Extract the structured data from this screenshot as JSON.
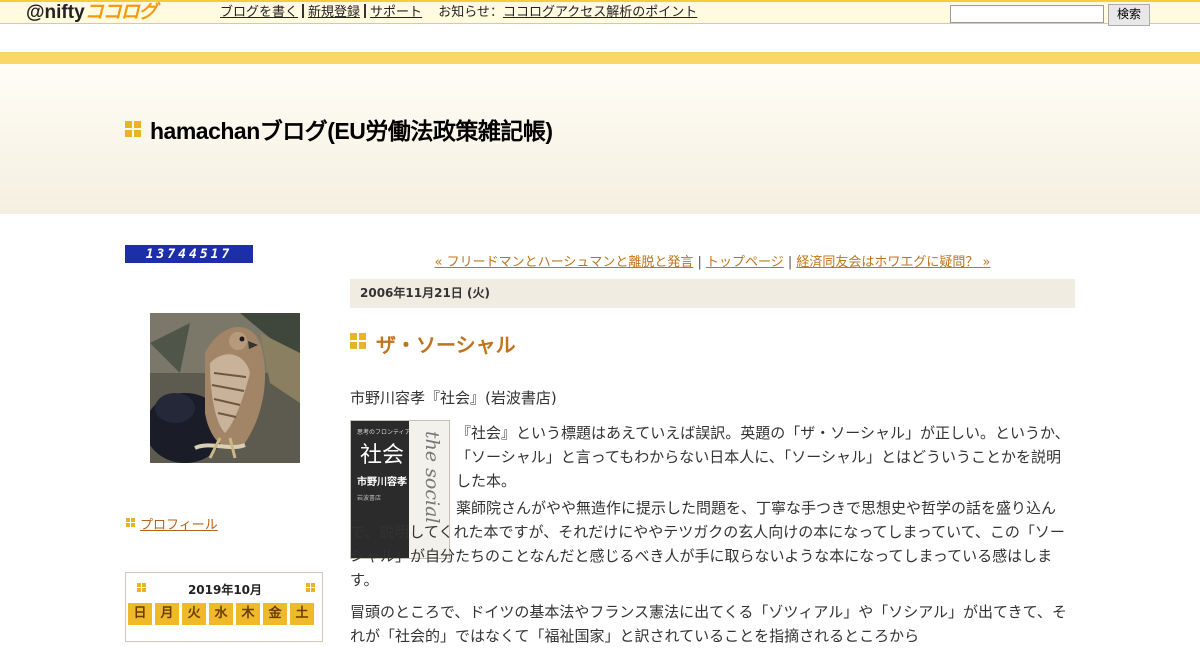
{
  "topbar": {
    "logo_at": "@nifty",
    "logo_coco": "ココログ",
    "nav": [
      {
        "label": "ブログを書く"
      },
      {
        "label": "新規登録"
      },
      {
        "label": "サポート"
      }
    ],
    "news_prefix": "お知らせ",
    "news_colon": "：",
    "news_link": "ココログアクセス解析のポイント",
    "search_placeholder": "",
    "search_button": "検索"
  },
  "header": {
    "blog_title": "hamachanブログ(EU労働法政策雑記帳)"
  },
  "sidebar": {
    "counter": "13744517",
    "profile_link": "プロフィール",
    "calendar": {
      "title": "2019年10月",
      "weekdays": [
        "日",
        "月",
        "火",
        "水",
        "木",
        "金",
        "土"
      ]
    }
  },
  "main": {
    "nav": {
      "prev": "« フリードマンとハーシュマンと離脱と発言",
      "sep1": " | ",
      "top": "トップページ",
      "sep2": " | ",
      "next": "経済同友会はホワエグに疑問？ »"
    },
    "date": "2006年11月21日 (火)",
    "entry_title": "ザ・ソーシャル",
    "book_line": "市野川容孝『社会』(岩波書店)",
    "book_cover": {
      "series": "思考のフロンティア",
      "title": "社会",
      "author": "市野川容孝",
      "script": "the social",
      "publisher": "岩波書店"
    },
    "paragraph1": "『社会』という標題はあえていえば誤訳。英題の「ザ・ソーシャル」が正しい。というか、「ソーシャル」と言ってもわからない日本人に、「ソーシャル」とはどういうことかを説明した本。",
    "paragraph2": "薬師院さんがやや無造作に提示した問題を、丁寧な手つきで思想史や哲学の話を盛り込んで、説明してくれた本ですが、それだけにややテツガクの玄人向けの本になってしまっていて、この「ソーシャル」が自分たちのことなんだと感じるべき人が手に取らないような本になってしまっている感はします。",
    "paragraph3": "冒頭のところで、ドイツの基本法やフランス憲法に出てくる「ゾツィアル」や「ソシアル」が出てきて、それが「社会的」ではなくて「福祉国家」と訳されていることを指摘されるところから"
  },
  "colors": {
    "accent": "#e9b326",
    "link": "#c0741c",
    "stripe": "#fbd76a"
  }
}
